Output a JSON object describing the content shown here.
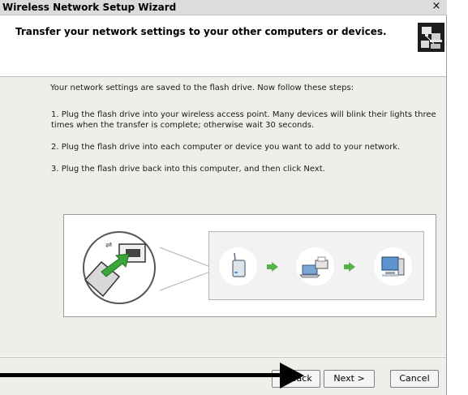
{
  "window": {
    "title": "Wireless Network Setup Wizard",
    "close_glyph": "×"
  },
  "header": {
    "title": "Transfer your network settings to your other computers or devices.",
    "icon": "network-devices-icon"
  },
  "body": {
    "intro": "Your network settings are saved to the flash drive. Now follow these steps:",
    "steps": [
      "1. Plug the flash drive into your wireless access point. Many devices will blink their lights three times when the transfer is complete; otherwise wait 30 seconds.",
      "2. Plug the flash drive into each computer or device you want to add to your network.",
      "3. Plug the flash drive back into this computer, and then click Next."
    ]
  },
  "illustration": {
    "items": [
      "usb-flash-drive-icon",
      "wireless-access-point-icon",
      "laptop-printer-icon",
      "computer-icon"
    ],
    "arrow_color": "#56b34a"
  },
  "buttons": {
    "back": "< Back",
    "next": "Next >",
    "cancel": "Cancel"
  },
  "colors": {
    "dialog_bg": "#efefea",
    "arrow": "#56b34a"
  }
}
